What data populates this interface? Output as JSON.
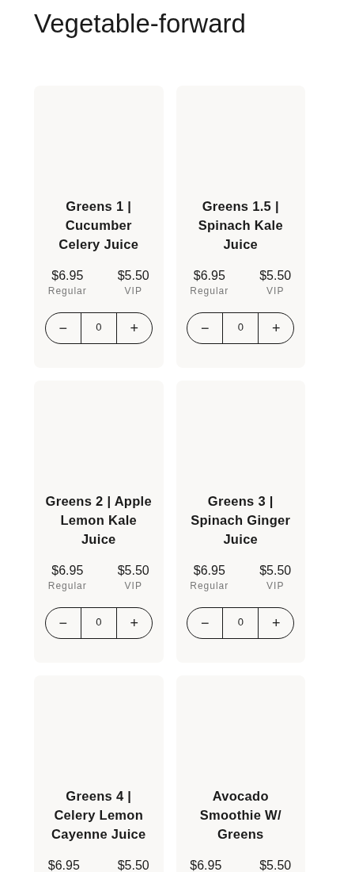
{
  "heading": "Vegetable-forward",
  "products": [
    {
      "name": "Greens 1 | Cucumber Celery Juice",
      "regular_price": "$6.95",
      "regular_label": "Regular",
      "vip_price": "$5.50",
      "vip_label": "VIP",
      "quantity": "0",
      "minus": "−",
      "plus": "+"
    },
    {
      "name": "Greens 1.5 | Spinach Kale Juice",
      "regular_price": "$6.95",
      "regular_label": "Regular",
      "vip_price": "$5.50",
      "vip_label": "VIP",
      "quantity": "0",
      "minus": "−",
      "plus": "+"
    },
    {
      "name": "Greens 2 | Apple Lemon Kale Juice",
      "regular_price": "$6.95",
      "regular_label": "Regular",
      "vip_price": "$5.50",
      "vip_label": "VIP",
      "quantity": "0",
      "minus": "−",
      "plus": "+"
    },
    {
      "name": "Greens 3 | Spinach Ginger Juice",
      "regular_price": "$6.95",
      "regular_label": "Regular",
      "vip_price": "$5.50",
      "vip_label": "VIP",
      "quantity": "0",
      "minus": "−",
      "plus": "+"
    },
    {
      "name": "Greens 4 | Celery Lemon Cayenne Juice",
      "regular_price": "$6.95",
      "vip_price": "$5.50"
    },
    {
      "name": "Avocado Smoothie W/ Greens",
      "regular_price": "$6.95",
      "vip_price": "$5.50"
    }
  ]
}
